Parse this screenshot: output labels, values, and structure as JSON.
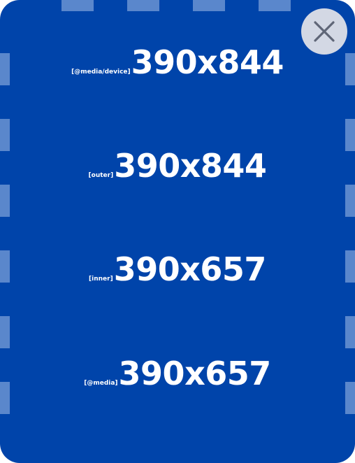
{
  "measurements": [
    {
      "tag": "[@media/device]",
      "value": "390x844"
    },
    {
      "tag": "[outer]",
      "value": "390x844"
    },
    {
      "tag": "[inner]",
      "value": "390x657"
    },
    {
      "tag": "[@media]",
      "value": "390x657"
    }
  ],
  "close_button": {
    "icon": "close-icon"
  },
  "colors": {
    "background": "#0044aa",
    "border_marks": "#5a87cc",
    "text": "#ffffff",
    "close_button_bg": "#d3d8e4",
    "close_icon": "#5f6677"
  }
}
